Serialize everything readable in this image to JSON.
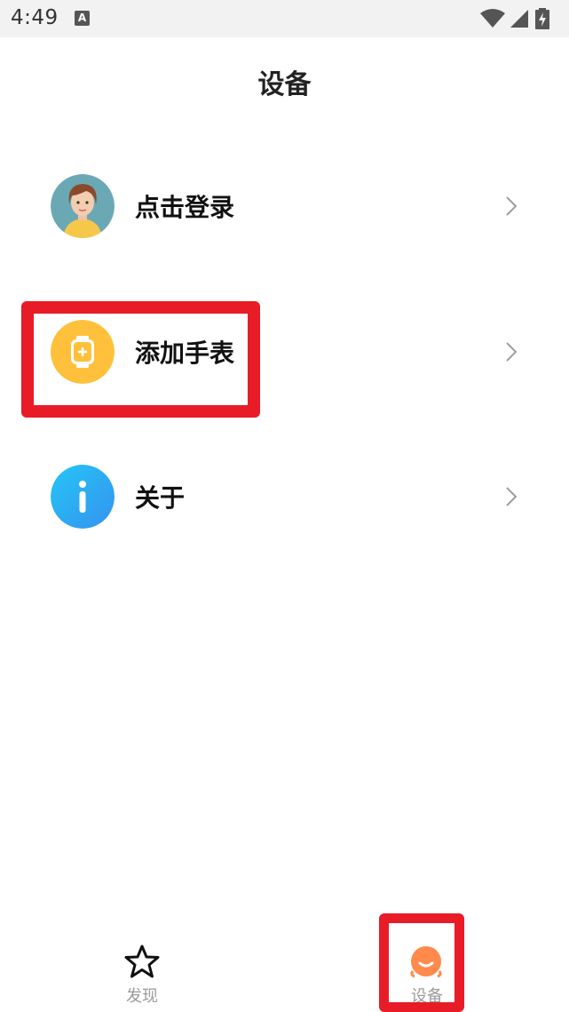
{
  "status_bar": {
    "time": "4:49",
    "notification_icon": "text-a-icon",
    "icons": [
      "wifi-icon",
      "signal-icon",
      "battery-charging-icon"
    ]
  },
  "header": {
    "title": "设备"
  },
  "menu": {
    "items": [
      {
        "label": "点击登录",
        "icon": "user-avatar-icon",
        "chevron": "chevron-right-icon"
      },
      {
        "label": "添加手表",
        "icon": "add-watch-icon",
        "chevron": "chevron-right-icon"
      },
      {
        "label": "关于",
        "icon": "info-icon",
        "chevron": "chevron-right-icon"
      }
    ]
  },
  "tab_bar": {
    "tabs": [
      {
        "label": "发现",
        "icon": "star-icon",
        "active": false
      },
      {
        "label": "设备",
        "icon": "device-face-icon",
        "active": true
      }
    ]
  },
  "colors": {
    "highlight": "#e81c27",
    "watch_icon_bg": "#ffc13b",
    "info_icon_bg": "#2aa9f5",
    "avatar_bg": "#6aa9b4",
    "active_tab_icon": "#ff8a4c"
  }
}
